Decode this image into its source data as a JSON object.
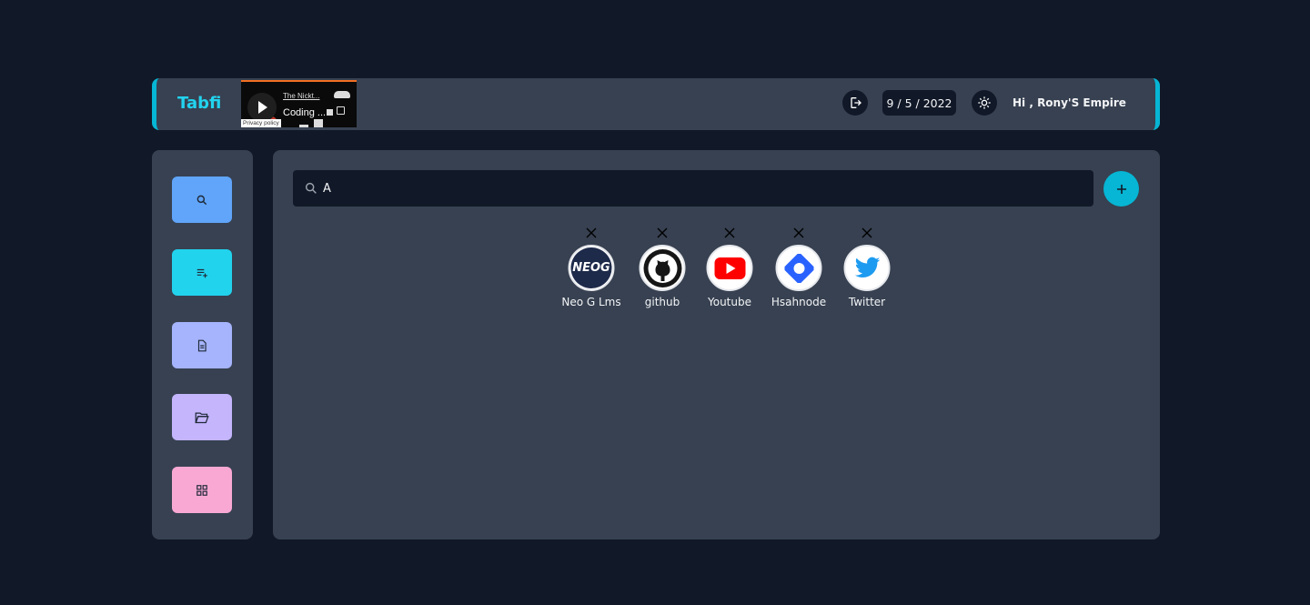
{
  "header": {
    "brand": "Tabfi",
    "player": {
      "artist": "The Nickt...",
      "track": "Coding ...",
      "privacy": "Privacy policy"
    },
    "date": "9 / 5 / 2022",
    "greeting": "Hi , Rony'S Empire",
    "icons": {
      "logout": "logout-icon",
      "theme": "sun-icon"
    }
  },
  "sidebar": {
    "items": [
      {
        "icon": "search-icon",
        "color": "#60a5fa"
      },
      {
        "icon": "playlist-add-icon",
        "color": "#22d3ee"
      },
      {
        "icon": "document-icon",
        "color": "#a5b4fc"
      },
      {
        "icon": "folder-open-icon",
        "color": "#c4b5fd"
      },
      {
        "icon": "dashboard-icon",
        "color": "#f9a8d4"
      }
    ]
  },
  "main": {
    "search": {
      "value": "A"
    },
    "add_icon": "plus-icon",
    "shortcuts": [
      {
        "label": "Neo G Lms",
        "icon": "neog-logo-icon",
        "logo_text": "NEOG"
      },
      {
        "label": "github",
        "icon": "github-logo-icon"
      },
      {
        "label": "Youtube",
        "icon": "youtube-logo-icon"
      },
      {
        "label": "Hsahnode",
        "icon": "hashnode-logo-icon"
      },
      {
        "label": "Twitter",
        "icon": "twitter-logo-icon"
      }
    ]
  },
  "colors": {
    "background": "#111827",
    "panel": "#374151",
    "accent": "#06b6d4",
    "brand_text": "#22d3ee"
  }
}
